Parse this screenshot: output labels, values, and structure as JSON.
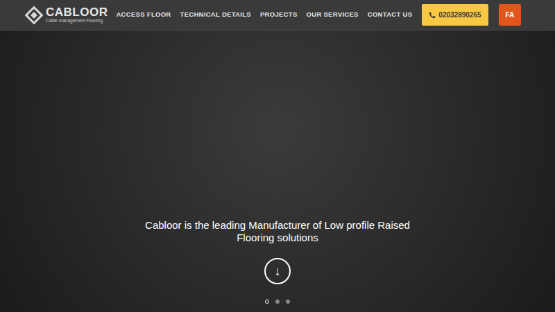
{
  "logo": {
    "name": "CABLOOR",
    "tagline": "Cable management Flooring"
  },
  "nav": [
    {
      "label": "ACCESS FLOOR"
    },
    {
      "label": "TECHNICAL DETAILS"
    },
    {
      "label": "PROJECTS"
    },
    {
      "label": "OUR SERVICES"
    },
    {
      "label": "CONTACT US"
    }
  ],
  "phone_button": {
    "label": "02032890265"
  },
  "language_button": {
    "label": "FA"
  },
  "hero": {
    "lines": [
      "Cabloor is the leading Manufacturer of Low profile Raised",
      "Flooring solutions"
    ],
    "scroll_button": {
      "label": "↓"
    },
    "slides": [
      {
        "selected": true
      },
      {
        "selected": false
      },
      {
        "selected": false
      }
    ]
  }
}
